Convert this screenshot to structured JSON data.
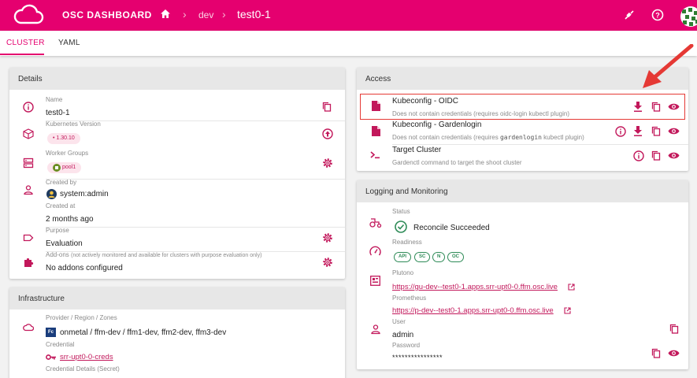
{
  "app": {
    "title": "OSC DASHBOARD"
  },
  "breadcrumb": {
    "project": "dev",
    "cluster": "test0-1"
  },
  "tabs": [
    {
      "label": "CLUSTER"
    },
    {
      "label": "YAML"
    }
  ],
  "details": {
    "title": "Details",
    "name_label": "Name",
    "name_value": "test0-1",
    "k8s_label": "Kubernetes Version",
    "k8s_value": "• 1.30.10",
    "worker_label": "Worker Groups",
    "worker_value": "pool1",
    "created_by_label": "Created by",
    "created_by_value": "system:admin",
    "created_at_label": "Created at",
    "created_at_value": "2 months ago",
    "purpose_label": "Purpose",
    "purpose_value": "Evaluation",
    "addons_label": "Add-ons",
    "addons_note": "(not actively monitored and available for clusters with purpose evaluation only)",
    "addons_value": "No addons configured"
  },
  "infrastructure": {
    "title": "Infrastructure",
    "provider_label": "Provider / Region / Zones",
    "provider_badge": "Fc",
    "provider_value": "onmetal / ffm-dev / ffm1-dev, ffm2-dev, ffm3-dev",
    "credential_label": "Credential",
    "credential_value": "srr-upt0-0-creds",
    "credential_details_label": "Credential Details (Secret)"
  },
  "access": {
    "title": "Access",
    "items": [
      {
        "title": "Kubeconfig - OIDC",
        "subtitle": "Does not contain credentials (requires oidc-login kubectl plugin)"
      },
      {
        "title": "Kubeconfig - Gardenlogin",
        "subtitle_pre": "Does not contain credentials (requires ",
        "subtitle_code": "gardenlogin",
        "subtitle_post": " kubectl plugin)"
      },
      {
        "title": "Target Cluster",
        "subtitle": "Gardenctl command to target the shoot cluster"
      }
    ]
  },
  "logging": {
    "title": "Logging and Monitoring",
    "status_label": "Status",
    "status_value": "Reconcile Succeeded",
    "readiness_label": "Readiness",
    "readiness_chips": [
      "API",
      "SC",
      "N",
      "OC"
    ],
    "plutono_label": "Plutono",
    "plutono_url": "https://gu-dev--test0-1.apps.srr-upt0-0.ffm.osc.live",
    "prometheus_label": "Prometheus",
    "prometheus_url": "https://p-dev--test0-1.apps.srr-upt0-0.ffm.osc.live",
    "user_label": "User",
    "user_value": "admin",
    "password_label": "Password",
    "password_value": "****************"
  },
  "colors": {
    "brand": "#e5006f",
    "accent": "#c2185b",
    "success": "#2e8b57",
    "annotation": "#e53935"
  }
}
